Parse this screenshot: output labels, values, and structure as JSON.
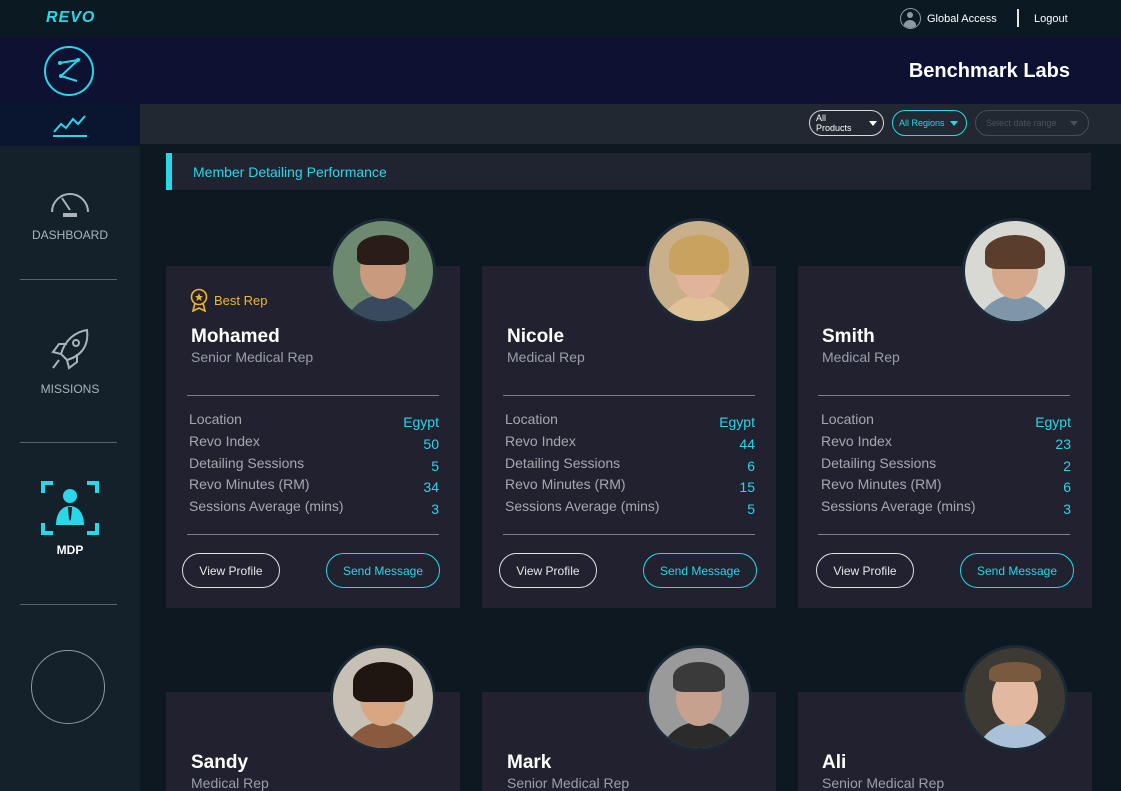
{
  "app": {
    "brand": "REVO",
    "company": "Benchmark Labs"
  },
  "topbar": {
    "global_access": "Global Access",
    "logout": "Logout"
  },
  "sidebar": {
    "items": [
      {
        "label": "DASHBOARD",
        "icon": "speedometer-icon"
      },
      {
        "label": "MISSIONS",
        "icon": "rocket-icon"
      },
      {
        "label": "MDP",
        "icon": "user-focus-icon",
        "active": true
      }
    ]
  },
  "filters": {
    "products": "All Products",
    "regions": "All Regions",
    "date_range_placeholder": "Select date range"
  },
  "section_title": "Member Detailing Performance",
  "stat_labels": [
    "Location",
    "Revo Index",
    "Detailing Sessions",
    "Revo Minutes (RM)",
    "Sessions Average (mins)"
  ],
  "buttons": {
    "view_profile": "View Profile",
    "send_message": "Send Message"
  },
  "badge": {
    "best_rep": "Best Rep"
  },
  "members": [
    {
      "name": "Mohamed",
      "role": "Senior Medical Rep",
      "best_rep": true,
      "location": "Egypt",
      "revo_index": "50",
      "detailing_sessions": "5",
      "revo_minutes": "34",
      "sessions_average": "3"
    },
    {
      "name": "Nicole",
      "role": "Medical Rep",
      "location": "Egypt",
      "revo_index": "44",
      "detailing_sessions": "6",
      "revo_minutes": "15",
      "sessions_average": "5"
    },
    {
      "name": "Smith",
      "role": "Medical Rep",
      "location": "Egypt",
      "revo_index": "23",
      "detailing_sessions": "2",
      "revo_minutes": "6",
      "sessions_average": "3"
    },
    {
      "name": "Sandy",
      "role": "Medical Rep"
    },
    {
      "name": "Mark",
      "role": "Senior Medical Rep"
    },
    {
      "name": "Ali",
      "role": "Senior Medical Rep"
    }
  ],
  "colors": {
    "accent": "#28d7e8",
    "gold": "#f0b72b",
    "card_bg": "#212130",
    "sidebar_bg": "#14212b"
  }
}
